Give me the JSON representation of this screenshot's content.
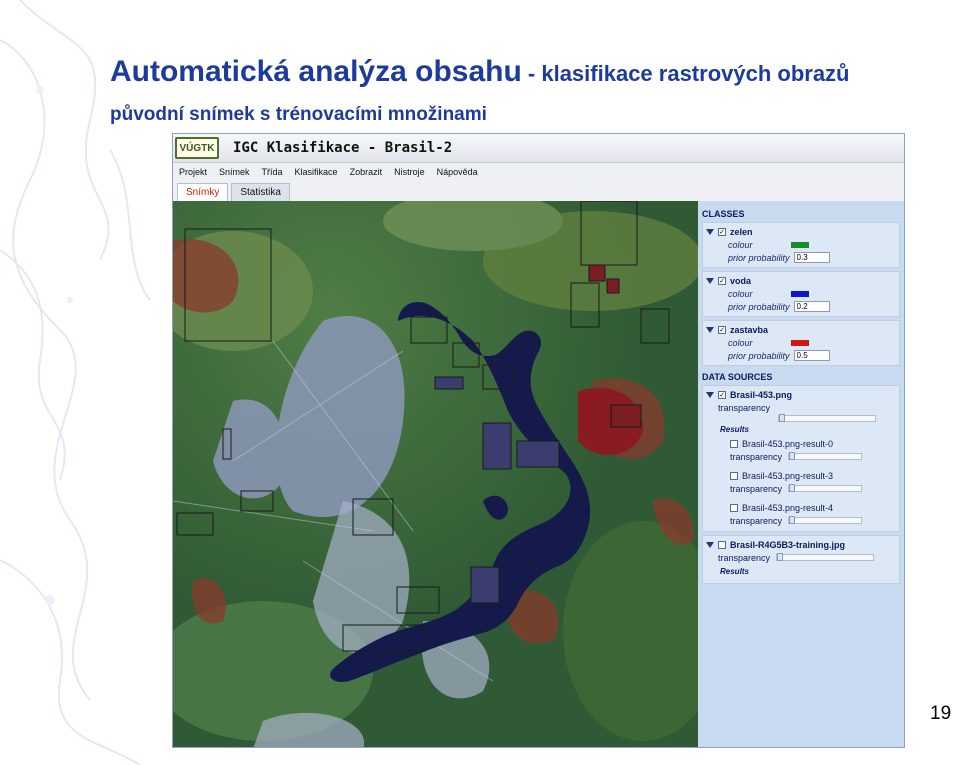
{
  "slide": {
    "title_main": "Automatická analýza obsahu",
    "title_suffix": " - klasifikace rastrových obrazů",
    "subtitle": "původní snímek s trénovacími množinami",
    "page_number": "19"
  },
  "app": {
    "logo_text": "VÚGTK",
    "title": "IGC Klasifikace - Brasil-2",
    "menu": [
      "Projekt",
      "Snímek",
      "Třída",
      "Klasifikace",
      "Zobrazit",
      "Nistroje",
      "Nápověda"
    ],
    "tabs": [
      {
        "label": "Snímky",
        "active": true
      },
      {
        "label": "Statistika",
        "active": false
      }
    ]
  },
  "classes": {
    "heading": "CLASSES",
    "colour_label": "colour",
    "prob_label": "prior probability",
    "items": [
      {
        "name": "zelen",
        "checked": true,
        "color": "#1a8a2a",
        "prior_probability": "0.3"
      },
      {
        "name": "voda",
        "checked": true,
        "color": "#1414c8",
        "prior_probability": "0.2"
      },
      {
        "name": "zastavba",
        "checked": true,
        "color": "#d01818",
        "prior_probability": "0.5"
      }
    ]
  },
  "data_sources": {
    "heading": "DATA SOURCES",
    "transparency_label": "transparency",
    "results_label": "Results",
    "sources": [
      {
        "name": "Brasil-453.png",
        "checked": true,
        "results": [
          {
            "name": "Brasil-453.png-result-0",
            "checked": false
          },
          {
            "name": "Brasil-453.png-result-3",
            "checked": false
          },
          {
            "name": "Brasil-453.png-result-4",
            "checked": false
          }
        ]
      },
      {
        "name": "Brasil-R4G5B3-training.jpg",
        "checked": false,
        "results": []
      }
    ]
  },
  "colors": {
    "title_blue": "#1d3b9c",
    "panel_bg": "#c8daef",
    "water": "#141a4a"
  }
}
